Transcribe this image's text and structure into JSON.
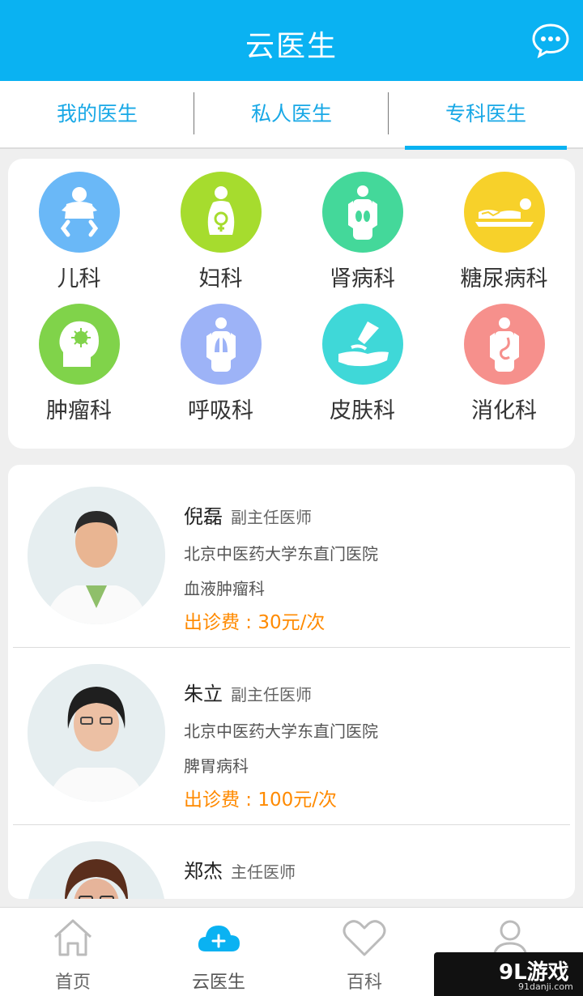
{
  "header": {
    "title": "云医生",
    "message_icon": "chat-bubble-icon",
    "bg_color": "#0ab2f2"
  },
  "tabs": [
    {
      "label": "我的医生",
      "active": false
    },
    {
      "label": "私人医生",
      "active": false
    },
    {
      "label": "专科医生",
      "active": true
    }
  ],
  "departments": [
    {
      "label": "儿科",
      "icon": "baby-icon",
      "color": "#6ab8f7"
    },
    {
      "label": "妇科",
      "icon": "pregnant-woman-icon",
      "color": "#a6dc2e"
    },
    {
      "label": "肾病科",
      "icon": "kidney-icon",
      "color": "#44d89a"
    },
    {
      "label": "糖尿病科",
      "icon": "patient-bed-icon",
      "color": "#f7d12a"
    },
    {
      "label": "肿瘤科",
      "icon": "tumor-head-icon",
      "color": "#80d34a"
    },
    {
      "label": "呼吸科",
      "icon": "lungs-icon",
      "color": "#9db3f7"
    },
    {
      "label": "皮肤科",
      "icon": "skin-cream-hand-icon",
      "color": "#3fd8d8"
    },
    {
      "label": "消化科",
      "icon": "stomach-icon",
      "color": "#f6908c"
    }
  ],
  "doctors": [
    {
      "name": "倪磊",
      "rank": "副主任医师",
      "hospital": "北京中医药大学东直门医院",
      "department": "血液肿瘤科",
      "fee": "出诊费 : 30元/次"
    },
    {
      "name": "朱立",
      "rank": "副主任医师",
      "hospital": "北京中医药大学东直门医院",
      "department": "脾胃病科",
      "fee": "出诊费 : 100元/次"
    },
    {
      "name": "郑杰",
      "rank": "主任医师",
      "hospital": "",
      "department": "",
      "fee": ""
    }
  ],
  "bottom_nav": [
    {
      "label": "首页",
      "icon": "home-icon"
    },
    {
      "label": "云医生",
      "icon": "cloud-plus-icon",
      "active": true
    },
    {
      "label": "百科",
      "icon": "heart-icon"
    },
    {
      "label": "",
      "icon": "user-icon"
    }
  ],
  "watermark": {
    "text": "9L游戏",
    "sub": "91danji.com"
  }
}
